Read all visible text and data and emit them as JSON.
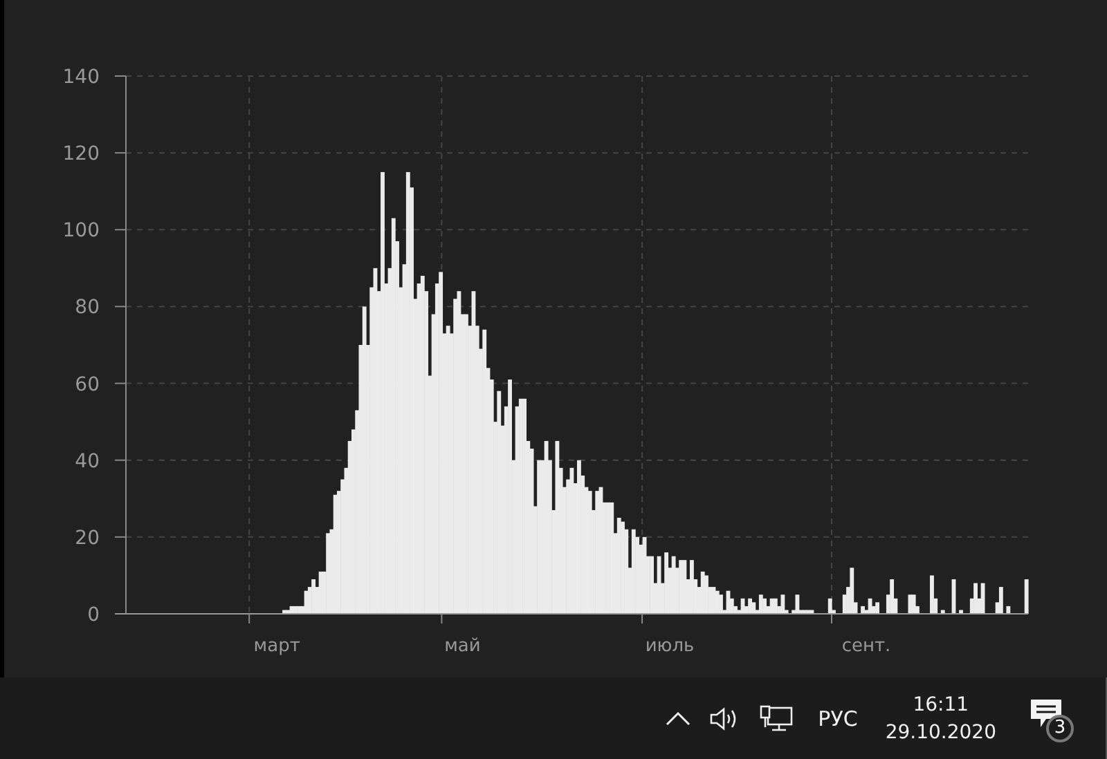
{
  "chart": {
    "chart_data": {
      "type": "bar",
      "grid": true,
      "ylim": [
        0,
        140
      ],
      "yticks": [
        0,
        20,
        40,
        60,
        80,
        100,
        120,
        140
      ],
      "categories": [
        null,
        null,
        null,
        null,
        null,
        null,
        null,
        null,
        null,
        null,
        null,
        null,
        null,
        null,
        null,
        null,
        null,
        null,
        null,
        null,
        null,
        null,
        null,
        null,
        null,
        null,
        null,
        null,
        null,
        null,
        null,
        null,
        null,
        null,
        null,
        null,
        null,
        null,
        null,
        null,
        null,
        "март",
        null,
        null,
        null,
        null,
        null,
        null,
        null,
        null,
        null,
        null,
        null,
        null,
        null,
        null,
        null,
        null,
        null,
        null,
        null,
        null,
        null,
        null,
        null,
        null,
        null,
        null,
        null,
        null,
        null,
        null,
        null,
        null,
        null,
        null,
        null,
        null,
        null,
        null,
        null,
        null,
        null,
        null,
        null,
        null,
        null,
        null,
        null,
        null,
        null,
        null,
        "май",
        null,
        null,
        null,
        null,
        null,
        null,
        null,
        null,
        null,
        null,
        null,
        null,
        null,
        null,
        null,
        null,
        null,
        null,
        null,
        null,
        null,
        null,
        null,
        null,
        null,
        null,
        null,
        null,
        null,
        null,
        null,
        null,
        null,
        null,
        null,
        null,
        null,
        null,
        null,
        null,
        null,
        null,
        null,
        null,
        null,
        null,
        null,
        null,
        null,
        null,
        null,
        null,
        null,
        null,
        null,
        null,
        "июль",
        null,
        null,
        null,
        null,
        null,
        null,
        null,
        null,
        null,
        null,
        null,
        null,
        null,
        null,
        null,
        null,
        null,
        null,
        null,
        null,
        null,
        null,
        null,
        null,
        null,
        null,
        null,
        null,
        null,
        null,
        null,
        null,
        null,
        null,
        null,
        null,
        null,
        null,
        null,
        null,
        null,
        null,
        null,
        null,
        null,
        null,
        null,
        null,
        null,
        null,
        null,
        null,
        null,
        "сент.",
        null,
        null,
        null,
        null,
        null,
        null,
        null,
        null,
        null,
        null,
        null,
        null,
        null,
        null,
        null,
        null,
        null,
        null,
        null,
        null,
        null,
        null,
        null,
        null,
        null,
        null,
        null,
        null,
        null,
        null,
        null,
        null,
        null,
        null,
        null,
        null,
        null,
        null,
        null,
        null,
        null,
        null,
        null,
        null
      ],
      "values": [
        0,
        0,
        0,
        0,
        0,
        0,
        0,
        0,
        0,
        0,
        0,
        0,
        0,
        0,
        0,
        0,
        0,
        0,
        0,
        0,
        0,
        0,
        0,
        0,
        0,
        0,
        0,
        0,
        0,
        0,
        0,
        0,
        0,
        0,
        0,
        0,
        0,
        0,
        0,
        0,
        0,
        0,
        0,
        1,
        1,
        2,
        2,
        2,
        2,
        6,
        7,
        9,
        7,
        11,
        11,
        21,
        22,
        31,
        32,
        35,
        38,
        45,
        48,
        53,
        70,
        80,
        70,
        85,
        90,
        84,
        115,
        86,
        90,
        103,
        97,
        85,
        91,
        115,
        111,
        82,
        86,
        88,
        84,
        62,
        78,
        86,
        89,
        73,
        75,
        73,
        82,
        84,
        78,
        78,
        75,
        84,
        75,
        69,
        74,
        64,
        61,
        50,
        58,
        49,
        54,
        61,
        40,
        54,
        56,
        56,
        45,
        43,
        28,
        40,
        40,
        45,
        40,
        27,
        45,
        38,
        33,
        35,
        38,
        34,
        40,
        36,
        33,
        32,
        27,
        32,
        33,
        29,
        29,
        29,
        21,
        25,
        24,
        22,
        12,
        22,
        20,
        18,
        20,
        15,
        15,
        8,
        15,
        8,
        16,
        12,
        15,
        12,
        14,
        14,
        9,
        14,
        9,
        7,
        11,
        10,
        7,
        7,
        6,
        5,
        1,
        6,
        4,
        2,
        1,
        4,
        2,
        4,
        3,
        1,
        5,
        4,
        2,
        4,
        4,
        2,
        5,
        1,
        0,
        1,
        5,
        1,
        1,
        1,
        1,
        0,
        0,
        0,
        0,
        4,
        1,
        0,
        0,
        5,
        7,
        12,
        3,
        0,
        2,
        1,
        4,
        2,
        3,
        0,
        0,
        5,
        9,
        4,
        0,
        0,
        0,
        5,
        5,
        2,
        0,
        0,
        0,
        10,
        4,
        0,
        1,
        0,
        0,
        9,
        0,
        1,
        0,
        0,
        4,
        8,
        4,
        8,
        0,
        0,
        0,
        3,
        7,
        0,
        2,
        0,
        0,
        0,
        0,
        9
      ]
    }
  },
  "taskbar": {
    "language": "РУС",
    "time": "16:11",
    "date": "29.10.2020",
    "notification_count": "3"
  }
}
